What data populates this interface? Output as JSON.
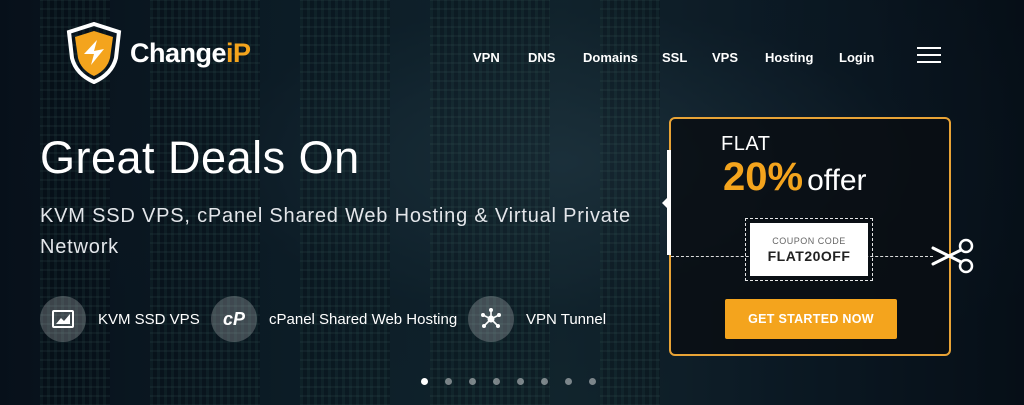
{
  "brand": {
    "name_main": "Change",
    "name_accent": "iP",
    "accent_color": "#f4a41d"
  },
  "nav": {
    "items": [
      {
        "label": "VPN"
      },
      {
        "label": "DNS"
      },
      {
        "label": "Domains"
      },
      {
        "label": "SSL"
      },
      {
        "label": "VPS"
      },
      {
        "label": "Hosting"
      },
      {
        "label": "Login"
      }
    ],
    "menu_icon": "hamburger-icon"
  },
  "hero": {
    "title": "Great Deals On",
    "subtitle": "KVM SSD VPS, cPanel Shared Web Hosting & Virtual Private Network",
    "features": [
      {
        "label": "KVM SSD VPS",
        "icon": "server-chart-icon"
      },
      {
        "label": "cPanel Shared Web Hosting",
        "icon": "cpanel-icon"
      },
      {
        "label": "VPN Tunnel",
        "icon": "network-hub-icon"
      }
    ]
  },
  "offer": {
    "flat_label": "FLAT",
    "percent": "20%",
    "offer_word": "offer",
    "coupon_label": "COUPON CODE",
    "coupon_code": "FLAT20OFF",
    "cta_label": "GET STARTED NOW",
    "scissors_icon": "scissors-icon",
    "border_color": "#e8a336"
  },
  "slider": {
    "slide_count": 8,
    "active_index": 0
  }
}
